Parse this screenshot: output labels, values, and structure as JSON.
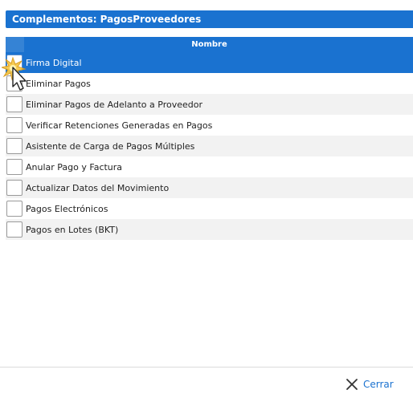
{
  "dialog": {
    "title": "Complementos: PagosProveedores"
  },
  "table": {
    "column_header": "Nombre",
    "rows": [
      {
        "label": "Firma Digital",
        "selected": true
      },
      {
        "label": "Eliminar Pagos",
        "selected": false
      },
      {
        "label": "Eliminar Pagos de Adelanto a Proveedor",
        "selected": false
      },
      {
        "label": "Verificar Retenciones Generadas en Pagos",
        "selected": false
      },
      {
        "label": "Asistente de Carga de Pagos Múltiples",
        "selected": false
      },
      {
        "label": "Anular Pago y Factura",
        "selected": false
      },
      {
        "label": "Actualizar Datos del Movimiento",
        "selected": false
      },
      {
        "label": "Pagos Electrónicos",
        "selected": false
      },
      {
        "label": "Pagos en Lotes (BKT)",
        "selected": false
      }
    ]
  },
  "footer": {
    "close_label": "Cerrar",
    "close_icon": "close-x-icon"
  },
  "colors": {
    "accent": "#1a72d0",
    "row_alt": "#f2f2f2"
  }
}
